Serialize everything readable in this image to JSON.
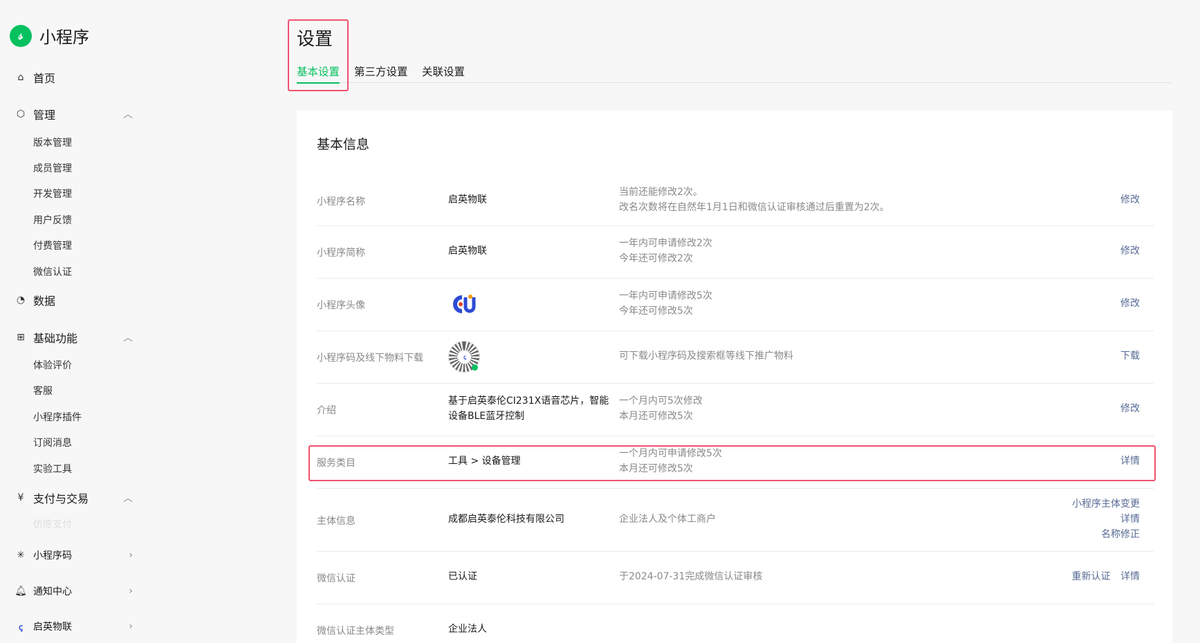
{
  "brand": {
    "title": "小程序",
    "logo_icon": "mini-program-logo"
  },
  "sidebar": {
    "home": "首页",
    "manage": {
      "label": "管理",
      "items": [
        "版本管理",
        "成员管理",
        "开发管理",
        "用户反馈",
        "付费管理",
        "微信认证"
      ]
    },
    "data": "数据",
    "basic": {
      "label": "基础功能",
      "items": [
        "体验评价",
        "客服",
        "小程序插件",
        "订阅消息",
        "实验工具"
      ]
    },
    "pay": {
      "label": "支付与交易",
      "faded": "仿陈支付"
    },
    "qrcode": "小程序码",
    "notify": "通知中心",
    "account": "启英物联"
  },
  "header": {
    "title": "设置",
    "tabs": [
      "基本设置",
      "第三方设置",
      "关联设置"
    ]
  },
  "card": {
    "title": "基本信息",
    "rows": [
      {
        "label": "小程序名称",
        "value": "启英物联",
        "desc": [
          "当前还能修改2次。",
          "改名次数将在自然年1月1日和微信认证审核通过后重置为2次。"
        ],
        "actions": [
          "修改"
        ]
      },
      {
        "label": "小程序简称",
        "value": "启英物联",
        "desc": [
          "一年内可申请修改2次",
          "今年还可修改2次"
        ],
        "actions": [
          "修改"
        ]
      },
      {
        "label": "小程序头像",
        "value": "",
        "desc": [
          "一年内可申请修改5次",
          "今年还可修改5次"
        ],
        "actions": [
          "修改"
        ]
      },
      {
        "label": "小程序码及线下物料下载",
        "value": "",
        "desc": [
          "可下载小程序码及搜索框等线下推广物料"
        ],
        "actions": [
          "下载"
        ]
      },
      {
        "label": "介绍",
        "value": "基于启英泰伦CI231X语音芯片，智能",
        "value2": "设备BLE蓝牙控制",
        "desc": [
          "一个月内可5次修改",
          "本月还可修改5次"
        ],
        "actions": [
          "修改"
        ]
      },
      {
        "label": "服务类目",
        "value": "工具 > 设备管理",
        "desc": [
          "一个月内可申请修改5次",
          "本月还可修改5次"
        ],
        "actions": [
          "详情"
        ]
      },
      {
        "label": "主体信息",
        "value": "成都启英泰伦科技有限公司",
        "desc": [
          "企业法人及个体工商户"
        ],
        "actions": [
          "小程序主体变更",
          "详情",
          "名称修正"
        ]
      },
      {
        "label": "微信认证",
        "value": "已认证",
        "desc": [
          "于2024-07-31完成微信认证审核"
        ],
        "actions": [
          "重新认证",
          "详情"
        ]
      },
      {
        "label": "微信认证主体类型",
        "value": "企业法人",
        "desc": [],
        "actions": []
      }
    ]
  },
  "colors": {
    "accent": "#07c160",
    "link": "#576b95",
    "highlight": "#f0506e"
  }
}
